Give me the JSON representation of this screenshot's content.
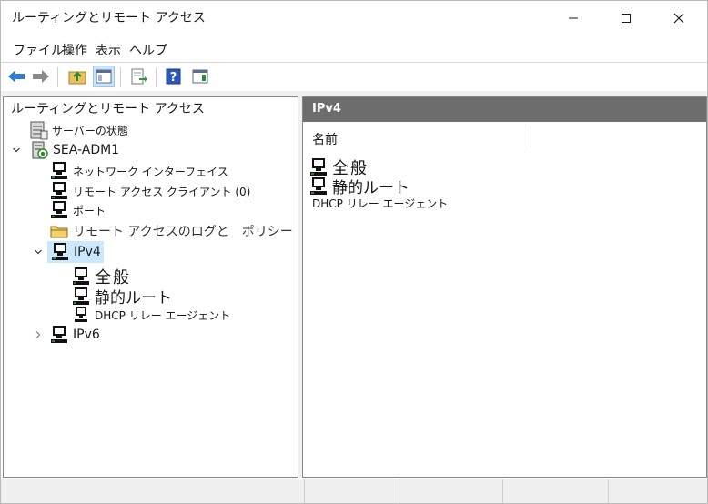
{
  "window": {
    "title": "ルーティングとリモート アクセス"
  },
  "menu": {
    "items": [
      "ファイル",
      "操作",
      "表示",
      "ヘルプ"
    ]
  },
  "toolbar": {
    "icons": [
      "back-arrow-icon",
      "forward-arrow-icon",
      "up-folder-icon",
      "show-hide-console-tree-icon",
      "export-list-icon",
      "help-icon",
      "action-pane-icon"
    ]
  },
  "tree": {
    "root": "ルーティングとリモート アクセス",
    "server_status": "サーバーの状態",
    "server": "SEA-ADM1",
    "network_interfaces": "ネットワーク インターフェイス",
    "remote_clients": "リモート アクセス クライアント (0)",
    "ports": "ポート",
    "logging_policy": "リモート アクセスのログと　ポリシー",
    "ipv4": "IPv4",
    "ipv4_general": "全般",
    "ipv4_static_routes": "静的ルート",
    "ipv4_dhcp_relay": "DHCP リレー エージェント",
    "ipv6": "IPv6"
  },
  "detail": {
    "header": "IPv4",
    "column_name": "名前",
    "items": [
      "全般",
      "静的ルート",
      "DHCP リレー エージェント"
    ]
  },
  "colors": {
    "selection": "#cce8ff",
    "header_band": "#6d6d6d"
  }
}
